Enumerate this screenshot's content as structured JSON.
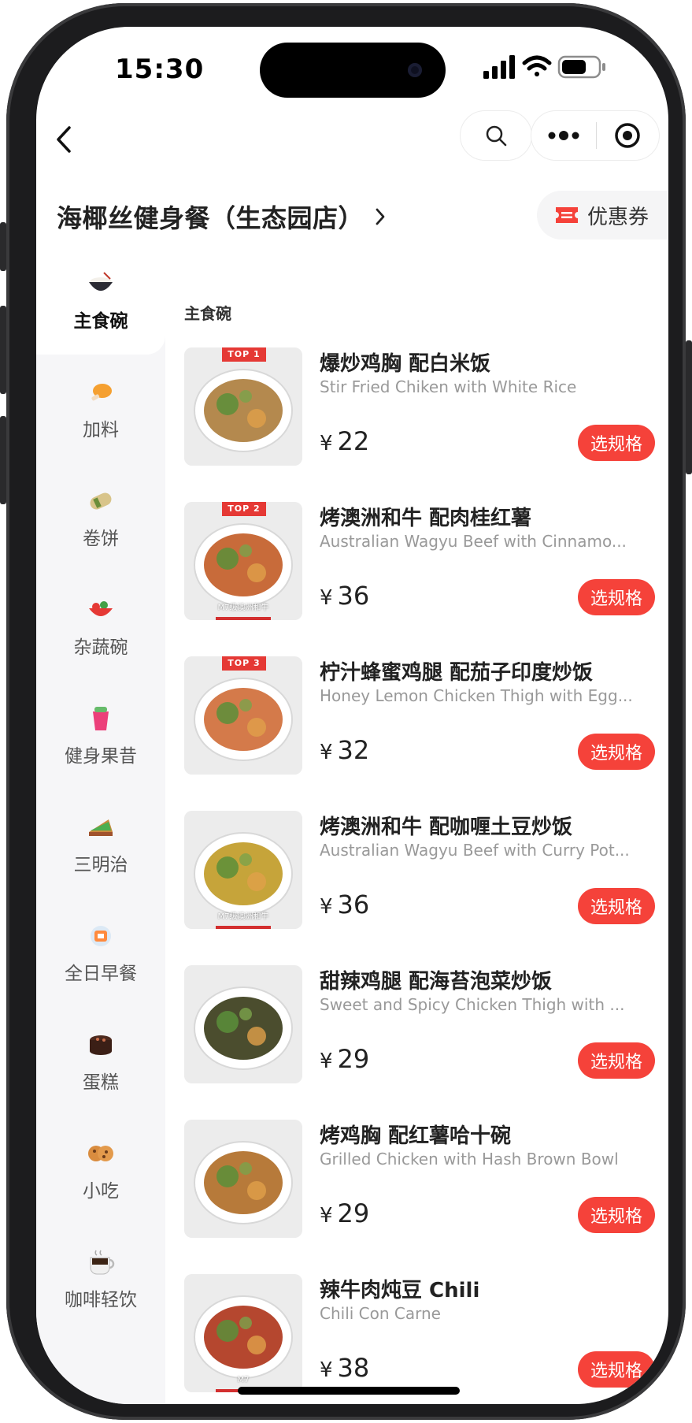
{
  "status": {
    "time": "15:30"
  },
  "store": {
    "title": "海椰丝健身餐（生态园店）",
    "coupon_label": "优惠券"
  },
  "colors": {
    "accent": "#f5423a",
    "sidebar_bg": "#f6f6f8",
    "top_tag": "#e53935"
  },
  "sidebar": {
    "items": [
      {
        "label": "主食碗",
        "icon": "rice-bowl-icon",
        "active": true
      },
      {
        "label": "加料",
        "icon": "drumstick-icon"
      },
      {
        "label": "卷饼",
        "icon": "burrito-icon"
      },
      {
        "label": "杂蔬碗",
        "icon": "salad-bowl-icon"
      },
      {
        "label": "健身果昔",
        "icon": "smoothie-icon"
      },
      {
        "label": "三明治",
        "icon": "sandwich-icon"
      },
      {
        "label": "全日早餐",
        "icon": "breakfast-icon"
      },
      {
        "label": "蛋糕",
        "icon": "cake-icon"
      },
      {
        "label": "小吃",
        "icon": "cookie-icon"
      },
      {
        "label": "咖啡轻饮",
        "icon": "coffee-icon"
      }
    ]
  },
  "main": {
    "section_title": "主食碗",
    "spec_label": "选规格",
    "currency": "¥",
    "items": [
      {
        "name": "爆炒鸡胸 配白米饭",
        "en": "Stir Fried Chiken with White Rice",
        "price": "22",
        "tag": "TOP 1",
        "caption": ""
      },
      {
        "name": "烤澳洲和牛 配肉桂红薯",
        "en": "Australian Wagyu Beef with Cinnamo...",
        "price": "36",
        "tag": "TOP 2",
        "caption": "M7级澳洲和牛"
      },
      {
        "name": "柠汁蜂蜜鸡腿 配茄子印度炒饭",
        "en": "Honey Lemon Chicken Thigh with Egg...",
        "price": "32",
        "tag": "TOP 3",
        "caption": ""
      },
      {
        "name": "烤澳洲和牛 配咖喱土豆炒饭",
        "en": "Australian Wagyu Beef with Curry Pot...",
        "price": "36",
        "tag": "",
        "caption": "M7级澳洲和牛"
      },
      {
        "name": "甜辣鸡腿 配海苔泡菜炒饭",
        "en": "Sweet and Spicy Chicken Thigh with ...",
        "price": "29",
        "tag": "",
        "caption": ""
      },
      {
        "name": "烤鸡胸 配红薯哈十碗",
        "en": "Grilled Chicken with Hash Brown Bowl",
        "price": "29",
        "tag": "",
        "caption": ""
      },
      {
        "name": "辣牛肉炖豆 Chili",
        "en": "Chili Con Carne",
        "price": "38",
        "tag": "",
        "caption": "M7"
      }
    ]
  }
}
